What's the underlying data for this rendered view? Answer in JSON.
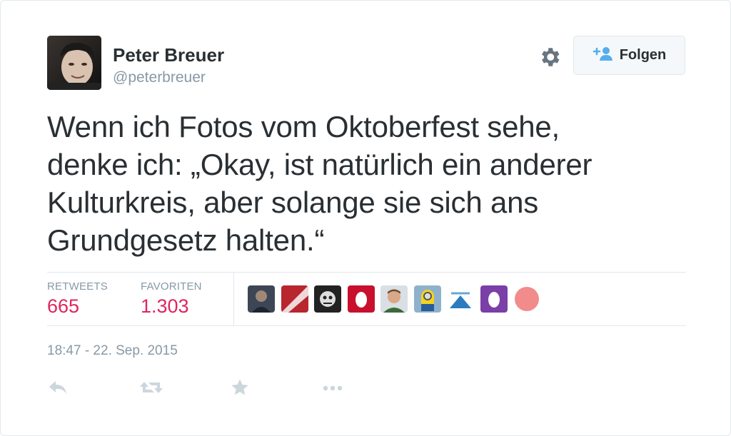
{
  "author": {
    "name": "Peter Breuer",
    "handle": "@peterbreuer"
  },
  "header": {
    "settings_icon": "gear-icon",
    "follow_button": {
      "label": "Folgen",
      "icon": "add-user-icon"
    }
  },
  "tweet": {
    "lines": [
      "Wenn ich Fotos vom Oktoberfest sehe,",
      "denke ich: „Okay, ist natürlich ein anderer",
      "Kulturkreis, aber solange sie sich ans",
      "Grundgesetz halten.“"
    ]
  },
  "stats": {
    "retweets_label": "RETWEETS",
    "retweets_value": "665",
    "favorites_label": "FAVORITEN",
    "favorites_value": "1.303"
  },
  "timestamp": "18:47 - 22. Sep. 2015",
  "actions": [
    "reply-icon",
    "retweet-icon",
    "favorite-icon",
    "more-icon"
  ],
  "colors": {
    "text": "#292f33",
    "muted": "#8899a6",
    "stat_value": "#e0245e",
    "border": "#e1e8ed",
    "action_icon": "#ccd6dd",
    "follow_icon": "#55acee"
  }
}
